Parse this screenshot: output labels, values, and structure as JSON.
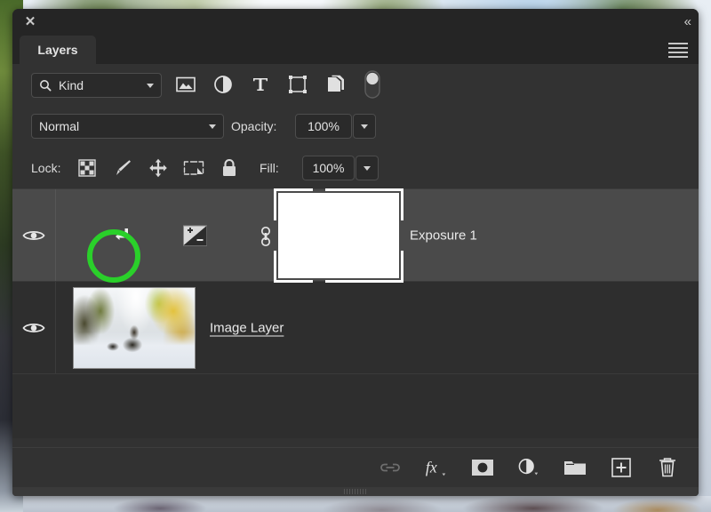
{
  "window": {
    "close_label": "✕",
    "collapse_label": "«",
    "menu_name": "panel-menu-icon"
  },
  "tab": {
    "label": "Layers"
  },
  "filter_bar": {
    "kind_label": "Kind",
    "search_icon": "search-icon",
    "icons": [
      {
        "name": "filter-pixel-layers-icon",
        "title": "Filter for pixel layers"
      },
      {
        "name": "filter-adjustment-layers-icon",
        "title": "Filter for adjustment layers"
      },
      {
        "name": "filter-type-layers-icon",
        "title": "Filter for type layers"
      },
      {
        "name": "filter-shape-layers-icon",
        "title": "Filter for shape layers"
      },
      {
        "name": "filter-smart-object-icon",
        "title": "Filter for smart objects"
      },
      {
        "name": "filter-toggle-switch",
        "title": "Turn layer filtering on/off"
      }
    ]
  },
  "blend_bar": {
    "blend_mode": "Normal",
    "opacity_label": "Opacity:",
    "opacity_value": "100%"
  },
  "lock_bar": {
    "lock_label": "Lock:",
    "icons": [
      {
        "name": "lock-transparent-pixels-icon"
      },
      {
        "name": "lock-image-pixels-icon"
      },
      {
        "name": "lock-position-icon"
      },
      {
        "name": "lock-artboard-nesting-icon"
      },
      {
        "name": "lock-all-icon"
      }
    ],
    "fill_label": "Fill:",
    "fill_value": "100%"
  },
  "layers": [
    {
      "name": "Exposure 1",
      "visible": true,
      "selected": true,
      "type": "adjustment",
      "adjustment_icon": "exposure-adjustment-icon",
      "clipping_mask_icon": "clipping-mask-arrow-icon",
      "link_icon": "link-mask-icon",
      "mask_thumbnail": "white-layer-mask",
      "mask_selected": true,
      "highlighted": true,
      "name_editing": false
    },
    {
      "name": "Image Layer",
      "visible": true,
      "selected": false,
      "type": "pixel",
      "thumbnail": "snowy-road-autumn-photo",
      "name_editing": true
    }
  ],
  "bottom_toolbar": {
    "icons": [
      {
        "name": "link-layers-icon",
        "label": "Link layers",
        "disabled": true
      },
      {
        "name": "layer-style-fx-icon",
        "label": "fx",
        "has_dropdown": true
      },
      {
        "name": "add-layer-mask-icon",
        "label": "Add layer mask"
      },
      {
        "name": "new-adjustment-layer-icon",
        "label": "New adjustment layer",
        "has_dropdown": true
      },
      {
        "name": "new-group-icon",
        "label": "New group"
      },
      {
        "name": "new-layer-icon",
        "label": "New layer"
      },
      {
        "name": "delete-layer-icon",
        "label": "Delete layer"
      }
    ]
  },
  "annotation": {
    "ring_color": "#2ad02a",
    "target": "clipping-mask-arrow-icon"
  }
}
